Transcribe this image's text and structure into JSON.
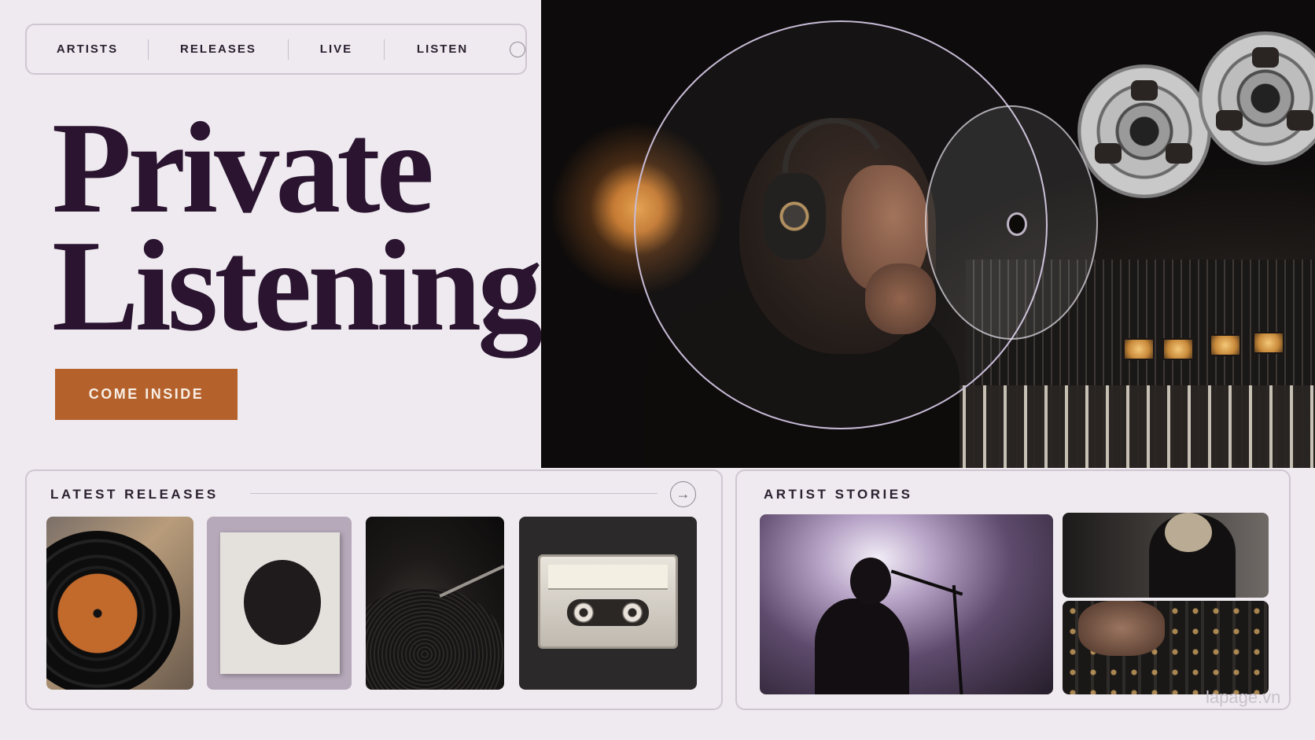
{
  "nav": {
    "items": [
      {
        "label": "ARTISTS"
      },
      {
        "label": "RELEASES"
      },
      {
        "label": "LIVE"
      },
      {
        "label": "LISTEN"
      }
    ]
  },
  "hero": {
    "title_line1": "Private",
    "title_line2": "Listening",
    "cta_label": "COME INSIDE"
  },
  "releases": {
    "title": "LATEST  RELEASES",
    "arrow": "→",
    "items": [
      {
        "name": "vinyl-record"
      },
      {
        "name": "album-cover"
      },
      {
        "name": "turntable"
      },
      {
        "name": "cassette-tape"
      }
    ]
  },
  "stories": {
    "title": "ARTIST STORIES"
  },
  "watermark": "lapage.vn",
  "colors": {
    "background": "#eeeaef",
    "title": "#2a1430",
    "accent": "#b5612c",
    "border": "#cfc6d2"
  }
}
